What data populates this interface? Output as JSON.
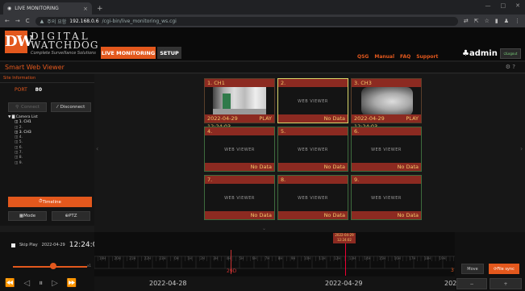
{
  "browser": {
    "tab_title": "LIVE MONITORING",
    "tab_close": "×",
    "new_tab": "+",
    "url_prefix": "주의 요함",
    "url_host": "192.168.0.6",
    "url_path": "/cgi-bin/live_monitoring_ws.cgi"
  },
  "header": {
    "logo_mark": "DW",
    "logo_line1": "DIGITAL",
    "logo_line2": "WATCHDOG",
    "logo_tagline": "Complete Surveillance Solutions",
    "nav_live": "LIVE MONITORING",
    "nav_setup": "SETUP",
    "links": [
      "QSG",
      "Manual",
      "FAQ",
      "Support"
    ],
    "user": "admin",
    "logout": "Logout"
  },
  "page_title": "Smart Web Viewer",
  "sidebar": {
    "section": "Site Information",
    "port_label": "PORT",
    "port_value": "80",
    "connect_label": "Connect",
    "disconnect_label": "Disconnect",
    "camera_list_label": "Camera List",
    "cameras": [
      "1. CH1",
      "2.",
      "3. CH3",
      "4.",
      "5.",
      "6.",
      "7.",
      "8.",
      "9."
    ],
    "timeline_label": "Timeline",
    "mode_label": "Mode",
    "ptz_label": "PTZ"
  },
  "grid": [
    {
      "label": "1. CH1",
      "status": "2022-04-29 12:24:03",
      "badge": "PLAY",
      "type": "cam1"
    },
    {
      "label": "2.",
      "status": "No Data",
      "badge": "",
      "type": "empty",
      "overlay": "WEB VIEWER"
    },
    {
      "label": "3. CH3",
      "status": "2022-04-29 12:24:03",
      "badge": "PLAY",
      "type": "cam3"
    },
    {
      "label": "4.",
      "status": "No Data",
      "badge": "",
      "type": "empty",
      "overlay": "WEB VIEWER"
    },
    {
      "label": "5.",
      "status": "No Data",
      "badge": "",
      "type": "empty",
      "overlay": "WEB VIEWER"
    },
    {
      "label": "6.",
      "status": "No Data",
      "badge": "",
      "type": "empty",
      "overlay": "WEB VIEWER"
    },
    {
      "label": "7.",
      "status": "No Data",
      "badge": "",
      "type": "empty",
      "overlay": "WEB VIEWER"
    },
    {
      "label": "8.",
      "status": "No Data",
      "badge": "",
      "type": "empty",
      "overlay": "WEB VIEWER"
    },
    {
      "label": "9.",
      "status": "No Data",
      "badge": "",
      "type": "empty",
      "overlay": "WEB VIEWER"
    }
  ],
  "playback": {
    "skip_label": "Skip Play",
    "date": "2022-04-29",
    "time": "12:24:02",
    "slider_max": "x1",
    "marker_date": "2022-04-29",
    "marker_time": "12:24:02",
    "ticks": [
      "19H",
      "20H",
      "21H",
      "22H",
      "23H",
      "0H",
      "1H",
      "2H",
      "3H",
      "4H",
      "5H",
      "6H",
      "7H",
      "8H",
      "9H",
      "10H",
      "11H",
      "12H",
      "13H",
      "14H",
      "15H",
      "16H",
      "17H",
      "18H",
      "19H"
    ],
    "day_label": "29D",
    "date_left": "2022-04-28",
    "date_mid": "2022-04-29",
    "date_right": "202",
    "right_num": "3",
    "move_label": "Move",
    "file_sync_label": "File sync",
    "zoom_out": "−",
    "zoom_in": "+"
  }
}
